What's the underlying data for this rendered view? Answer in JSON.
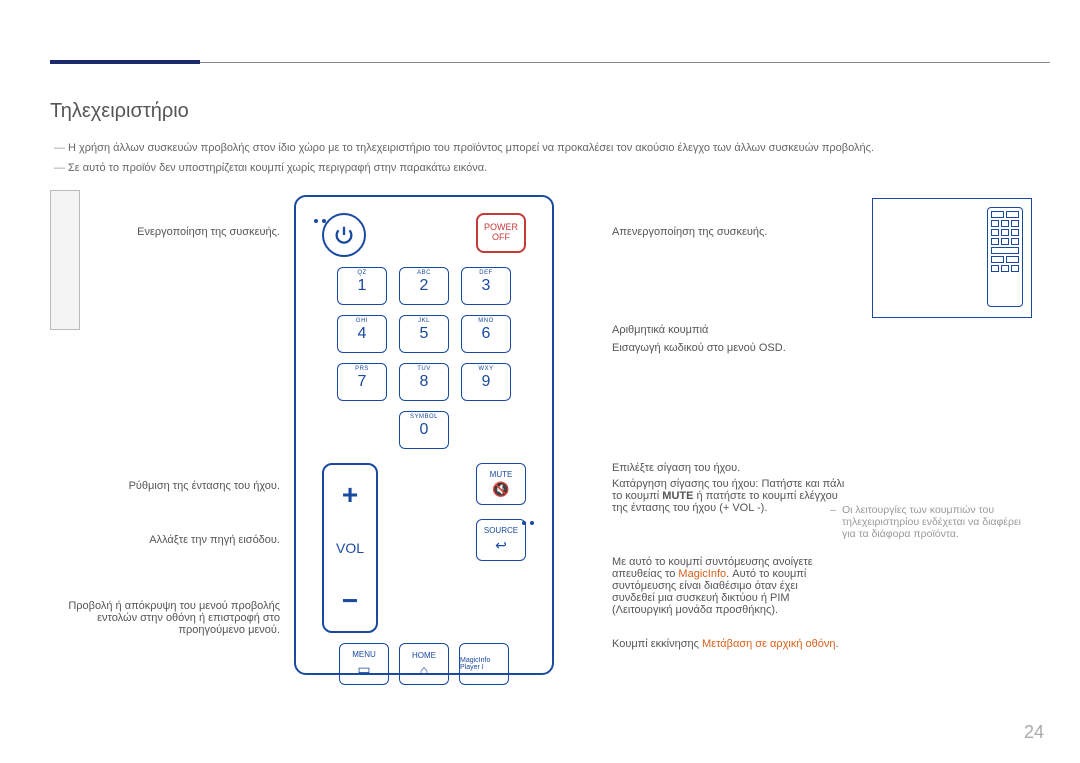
{
  "page_number": "24",
  "title": "Τηλεχειριστήριο",
  "notes": [
    "Η χρήση άλλων συσκευών προβολής στον ίδιο χώρο με το τηλεχειριστήριο του προϊόντος μπορεί να προκαλέσει τον ακούσιο έλεγχο των άλλων συσκευών προβολής.",
    "Σε αυτό το προϊόν δεν υποστηρίζεται κουμπί χωρίς περιγραφή στην παρακάτω εικόνα."
  ],
  "side_note": "Οι λειτουργίες των κουμπιών του τηλεχειριστηρίου ενδέχεται να διαφέρει για τα διάφορα προϊόντα.",
  "remote": {
    "power_off": "POWER OFF",
    "keys": [
      {
        "n": "1",
        "s": "QZ"
      },
      {
        "n": "2",
        "s": "ABC"
      },
      {
        "n": "3",
        "s": "DEF"
      },
      {
        "n": "4",
        "s": "GHI"
      },
      {
        "n": "5",
        "s": "JKL"
      },
      {
        "n": "6",
        "s": "MNO"
      },
      {
        "n": "7",
        "s": "PRS"
      },
      {
        "n": "8",
        "s": "TUV"
      },
      {
        "n": "9",
        "s": "WXY"
      },
      {
        "n": "0",
        "s": "SYMBOL"
      }
    ],
    "vol": "VOL",
    "mute": "MUTE",
    "source": "SOURCE",
    "menu": "MENU",
    "home": "HOME",
    "magicinfo": "MagicInfo Player I"
  },
  "left_callouts": {
    "power_on": "Ενεργοποίηση της συσκευής.",
    "volume": "Ρύθμιση της έντασης του ήχου.",
    "source": "Αλλάξτε την πηγή εισόδου.",
    "menu": "Προβολή ή απόκρυψη του μενού προβολής εντολών στην οθόνη ή επιστροφή στο προηγούμενο μενού."
  },
  "right_callouts": {
    "power_off": "Απενεργοποίηση της συσκευής.",
    "number_a": "Αριθμητικά κουμπιά",
    "number_b": "Εισαγωγή κωδικού στο μενού OSD.",
    "mute_a": "Επιλέξτε σίγαση του ήχου.",
    "mute_b_1": "Κατάργηση σίγασης του ήχου: Πατήστε και πάλι το κουμπί ",
    "mute_b_bold": "MUTE",
    "mute_b_2": " ή πατήστε το κουμπί ελέγχου της έντασης του ήχου (+ VOL -).",
    "magic_a": "Με αυτό το κουμπί συντόμευσης ανοίγετε απευθείας το ",
    "magic_brand": "MagicInfo",
    "magic_b": ". Αυτό το κουμπί συντόμευσης είναι διαθέσιμο όταν έχει συνδεθεί μια συσκευή δικτύου ή PIM (Λειτουργική μονάδα προσθήκης).",
    "home_a": "Κουμπί εκκίνησης ",
    "home_link": "Μετάβαση σε αρχική οθόνη",
    "home_b": "."
  }
}
